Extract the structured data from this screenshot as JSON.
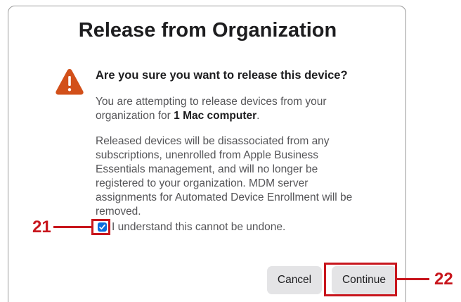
{
  "dialog": {
    "title": "Release from Organization",
    "question": "Are you sure you want to release this device?",
    "para1_prefix": "You are attempting to release devices from your organization for ",
    "para1_bold": "1 Mac computer",
    "para1_suffix": ".",
    "para2": "Released devices will be disassociated from any subscriptions, unenrolled from Apple Business Essentials management, and will no longer be registered to your organization. MDM server assignments for Automated Device Enrollment will be removed.",
    "checkbox_label": "I understand this cannot be undone.",
    "checkbox_checked": true,
    "cancel_label": "Cancel",
    "continue_label": "Continue"
  },
  "annotations": {
    "checkbox_callout": "21",
    "continue_callout": "22",
    "callout_color": "#c8161d"
  },
  "colors": {
    "warning": "#d2501a",
    "checkbox": "#0a6cdc",
    "button_bg": "#e4e4e6"
  },
  "icons": {
    "warning": "warning-triangle-icon",
    "check": "checkmark-icon"
  }
}
